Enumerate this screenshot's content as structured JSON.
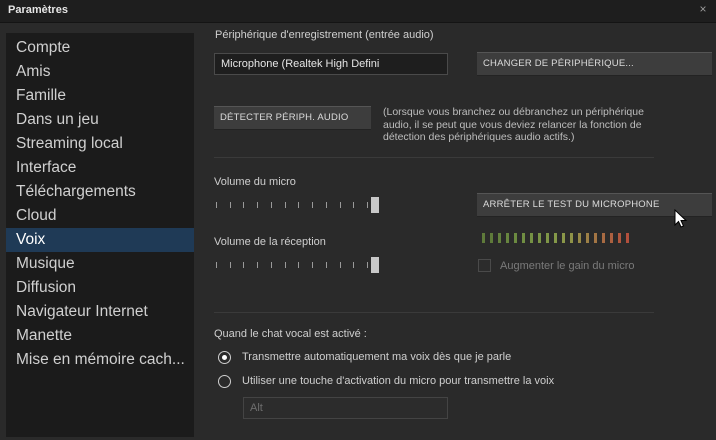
{
  "window": {
    "title": "Paramètres",
    "close_glyph": "×"
  },
  "sidebar": {
    "items": [
      {
        "label": "Compte"
      },
      {
        "label": "Amis"
      },
      {
        "label": "Famille"
      },
      {
        "label": "Dans un jeu"
      },
      {
        "label": "Streaming local"
      },
      {
        "label": "Interface"
      },
      {
        "label": "Téléchargements"
      },
      {
        "label": "Cloud"
      },
      {
        "label": "Voix"
      },
      {
        "label": "Musique"
      },
      {
        "label": "Diffusion"
      },
      {
        "label": "Navigateur Internet"
      },
      {
        "label": "Manette"
      },
      {
        "label": "Mise en mémoire cach..."
      }
    ],
    "selected": "Voix"
  },
  "recording": {
    "label": "Périphérique d'enregistrement (entrée audio)",
    "device_value": "Microphone (Realtek High Defini",
    "change_button": "CHANGER DE PÉRIPHÉRIQUE..."
  },
  "detect": {
    "button": "DÉTECTER PÉRIPH. AUDIO",
    "note_lines": [
      "(Lorsque vous branchez ou débranchez un périphérique",
      "audio, il se peut que vous deviez relancer la fonction de",
      "détection des périphériques audio actifs.)"
    ]
  },
  "mic": {
    "volume_label": "Volume du micro",
    "volume_level": 1.0,
    "stop_test_button": "ARRÊTER LE TEST DU MICROPHONE"
  },
  "reception": {
    "volume_label": "Volume de la réception",
    "volume_level": 1.0
  },
  "meter": {
    "colors": [
      "#5e7a3a",
      "#5e7a3a",
      "#63803d",
      "#67853f",
      "#6b8a40",
      "#708e42",
      "#759144",
      "#7a9446",
      "#7f9647",
      "#849848",
      "#8a9748",
      "#8f9348",
      "#978a47",
      "#9d8046",
      "#a37544",
      "#a86a42",
      "#ac6040",
      "#b0573e",
      "#b24f3c"
    ]
  },
  "gain": {
    "label": "Augmenter le gain du micro",
    "checked": false
  },
  "voice_chat": {
    "heading": "Quand le chat vocal est activé :",
    "options": [
      {
        "label": "Transmettre automatiquement ma voix dès que je parle",
        "selected": true
      },
      {
        "label": "Utiliser une touche d'activation du micro pour transmettre la voix",
        "selected": false
      }
    ],
    "hotkey_value": "Alt"
  }
}
